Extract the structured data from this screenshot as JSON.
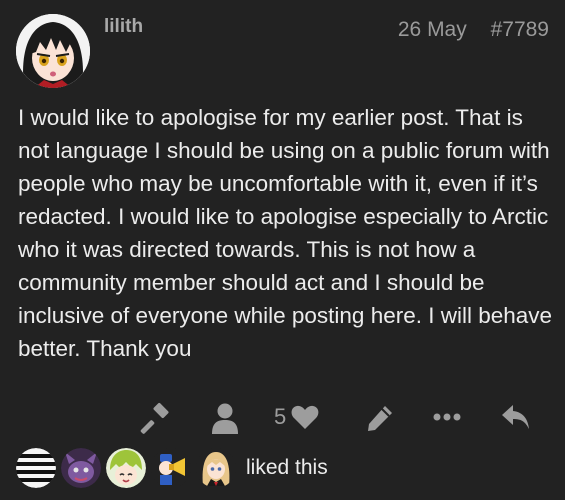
{
  "post": {
    "username": "lilith",
    "date": "26 May",
    "post_number": "#7789",
    "avatar_icon": "anime-girl-avatar",
    "body": "I would like to apologise for my earlier post. That is not language I should be using on a public forum with people who may be uncomfortable with it, even if it’s redacted. I would like to apologise especially to Arctic who it was directed towards. This is not how a community member should act and I should be inclusive of everyone while posting here. I will behave better. Thank you"
  },
  "actions": {
    "flag_icon": "gavel-icon",
    "user_icon": "user-icon",
    "like_count": "5",
    "like_icon": "heart-icon",
    "edit_icon": "pencil-icon",
    "more_icon": "ellipsis-icon",
    "reply_icon": "reply-icon"
  },
  "likes": {
    "text": "liked this",
    "avatars": [
      "striped-avatar",
      "purple-creature-avatar",
      "green-hair-avatar",
      "megaphone-avatar",
      "blonde-girl-avatar"
    ]
  },
  "colors": {
    "background": "#222222",
    "text": "#ececec",
    "muted": "#9d9d9d"
  }
}
